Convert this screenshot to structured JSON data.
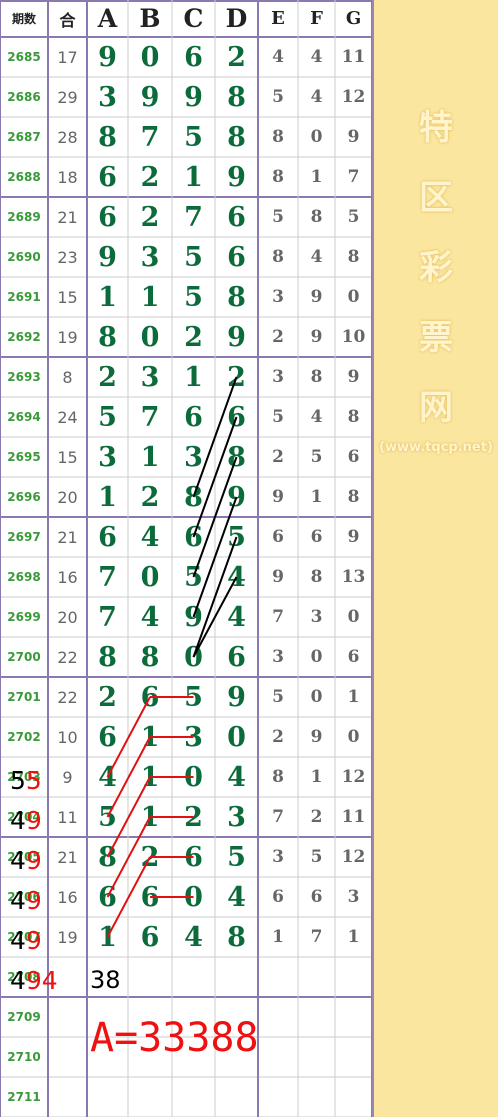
{
  "header": {
    "period": "期数",
    "sum": "合",
    "cols": [
      "A",
      "B",
      "C",
      "D",
      "E",
      "F",
      "G"
    ]
  },
  "rows": [
    {
      "period": "2685",
      "sum": "17",
      "abcd": [
        "9",
        "0",
        "6",
        "2"
      ],
      "efg": [
        "4",
        "4",
        "11"
      ]
    },
    {
      "period": "2686",
      "sum": "29",
      "abcd": [
        "3",
        "9",
        "9",
        "8"
      ],
      "efg": [
        "5",
        "4",
        "12"
      ]
    },
    {
      "period": "2687",
      "sum": "28",
      "abcd": [
        "8",
        "7",
        "5",
        "8"
      ],
      "efg": [
        "8",
        "0",
        "9"
      ]
    },
    {
      "period": "2688",
      "sum": "18",
      "abcd": [
        "6",
        "2",
        "1",
        "9"
      ],
      "efg": [
        "8",
        "1",
        "7"
      ]
    },
    {
      "period": "2689",
      "sum": "21",
      "abcd": [
        "6",
        "2",
        "7",
        "6"
      ],
      "efg": [
        "5",
        "8",
        "5"
      ]
    },
    {
      "period": "2690",
      "sum": "23",
      "abcd": [
        "9",
        "3",
        "5",
        "6"
      ],
      "efg": [
        "8",
        "4",
        "8"
      ]
    },
    {
      "period": "2691",
      "sum": "15",
      "abcd": [
        "1",
        "1",
        "5",
        "8"
      ],
      "efg": [
        "3",
        "9",
        "0"
      ]
    },
    {
      "period": "2692",
      "sum": "19",
      "abcd": [
        "8",
        "0",
        "2",
        "9"
      ],
      "efg": [
        "2",
        "9",
        "10"
      ]
    },
    {
      "period": "2693",
      "sum": "8",
      "abcd": [
        "2",
        "3",
        "1",
        "2"
      ],
      "efg": [
        "3",
        "8",
        "9"
      ]
    },
    {
      "period": "2694",
      "sum": "24",
      "abcd": [
        "5",
        "7",
        "6",
        "6"
      ],
      "efg": [
        "5",
        "4",
        "8"
      ]
    },
    {
      "period": "2695",
      "sum": "15",
      "abcd": [
        "3",
        "1",
        "3",
        "8"
      ],
      "efg": [
        "2",
        "5",
        "6"
      ]
    },
    {
      "period": "2696",
      "sum": "20",
      "abcd": [
        "1",
        "2",
        "8",
        "9"
      ],
      "efg": [
        "9",
        "1",
        "8"
      ]
    },
    {
      "period": "2697",
      "sum": "21",
      "abcd": [
        "6",
        "4",
        "6",
        "5"
      ],
      "efg": [
        "6",
        "6",
        "9"
      ]
    },
    {
      "period": "2698",
      "sum": "16",
      "abcd": [
        "7",
        "0",
        "5",
        "4"
      ],
      "efg": [
        "9",
        "8",
        "13"
      ]
    },
    {
      "period": "2699",
      "sum": "20",
      "abcd": [
        "7",
        "4",
        "9",
        "4"
      ],
      "efg": [
        "7",
        "3",
        "0"
      ]
    },
    {
      "period": "2700",
      "sum": "22",
      "abcd": [
        "8",
        "8",
        "0",
        "6"
      ],
      "efg": [
        "3",
        "0",
        "6"
      ]
    },
    {
      "period": "2701",
      "sum": "22",
      "abcd": [
        "2",
        "6",
        "5",
        "9"
      ],
      "efg": [
        "5",
        "0",
        "1"
      ]
    },
    {
      "period": "2702",
      "sum": "10",
      "abcd": [
        "6",
        "1",
        "3",
        "0"
      ],
      "efg": [
        "2",
        "9",
        "0"
      ]
    },
    {
      "period": "2703",
      "sum": "9",
      "abcd": [
        "4",
        "1",
        "0",
        "4"
      ],
      "efg": [
        "8",
        "1",
        "12"
      ]
    },
    {
      "period": "2704",
      "sum": "11",
      "abcd": [
        "5",
        "1",
        "2",
        "3"
      ],
      "efg": [
        "7",
        "2",
        "11"
      ]
    },
    {
      "period": "2705",
      "sum": "21",
      "abcd": [
        "8",
        "2",
        "6",
        "5"
      ],
      "efg": [
        "3",
        "5",
        "12"
      ]
    },
    {
      "period": "2706",
      "sum": "16",
      "abcd": [
        "6",
        "6",
        "0",
        "4"
      ],
      "efg": [
        "6",
        "6",
        "3"
      ]
    },
    {
      "period": "2707",
      "sum": "19",
      "abcd": [
        "1",
        "6",
        "4",
        "8"
      ],
      "efg": [
        "1",
        "7",
        "1"
      ]
    },
    {
      "period": "2708",
      "sum": "",
      "abcd": [
        "",
        "",
        "",
        ""
      ],
      "efg": [
        "",
        "",
        ""
      ]
    },
    {
      "period": "2709",
      "sum": "",
      "abcd": [
        "",
        "",
        "",
        ""
      ],
      "efg": [
        "",
        "",
        ""
      ]
    },
    {
      "period": "2710",
      "sum": "",
      "abcd": [
        "",
        "",
        "",
        ""
      ],
      "efg": [
        "",
        "",
        ""
      ]
    },
    {
      "period": "2711",
      "sum": "",
      "abcd": [
        "",
        "",
        "",
        ""
      ],
      "efg": [
        "",
        "",
        ""
      ]
    }
  ],
  "annotations": [
    {
      "black": "5",
      "red": "5"
    },
    {
      "black": "4",
      "red": "9"
    },
    {
      "black": "4",
      "red": "9"
    },
    {
      "black": "4",
      "red": "9"
    },
    {
      "black": "4",
      "red": "9"
    },
    {
      "black": "4",
      "red": "94"
    }
  ],
  "tail_number": "38",
  "formula": "A=33388",
  "watermark": {
    "chars": [
      "特",
      "区",
      "彩",
      "票",
      "网"
    ],
    "url": "(www.tqcp.net)"
  },
  "colors": {
    "grid_major": "#8a78b0",
    "grid_minor": "#cccccc",
    "digit": "#0c6b3a",
    "period": "#3a9a3a",
    "side_bg": "#fbe6a0",
    "red_line": "#e11111",
    "black_line": "#000000"
  }
}
